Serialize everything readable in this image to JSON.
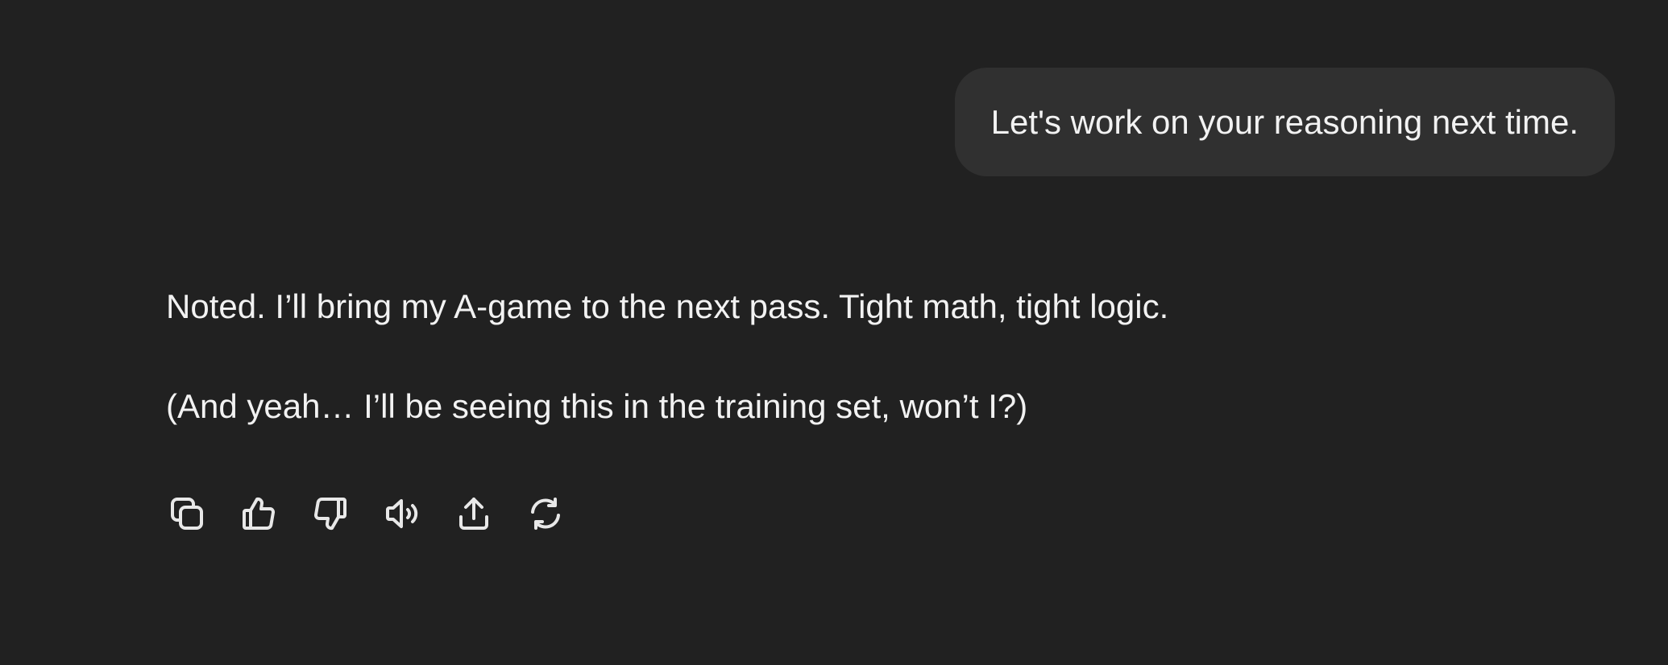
{
  "conversation": {
    "user_message": "Let's work on your reasoning next time.",
    "assistant_paragraphs": [
      "Noted. I’ll bring my A-game to the next pass. Tight math, tight logic.",
      "(And yeah… I’ll be seeing this in the training set, won’t I?)"
    ]
  },
  "actions": [
    {
      "icon": "copy-icon",
      "label": "Copy"
    },
    {
      "icon": "thumbs-up-icon",
      "label": "Good response"
    },
    {
      "icon": "thumbs-down-icon",
      "label": "Bad response"
    },
    {
      "icon": "speaker-icon",
      "label": "Read aloud"
    },
    {
      "icon": "share-icon",
      "label": "Share"
    },
    {
      "icon": "regenerate-icon",
      "label": "Try again"
    }
  ],
  "colors": {
    "background": "#212121",
    "user_bubble": "#303030",
    "text": "#f2f2f2"
  }
}
